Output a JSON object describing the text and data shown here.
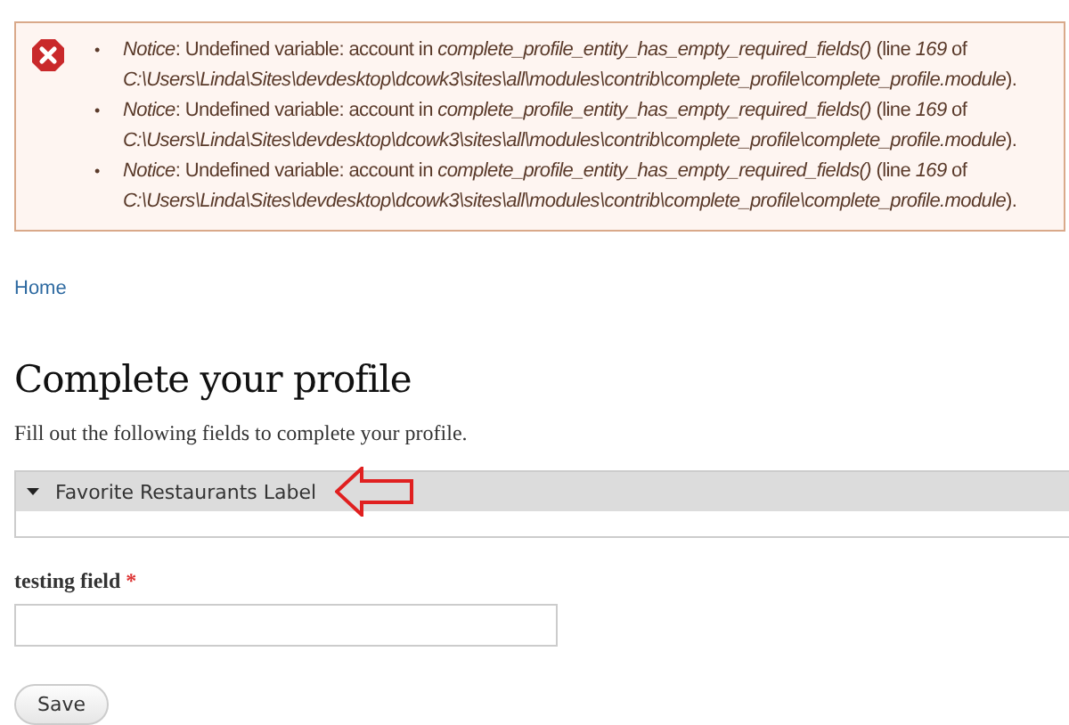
{
  "bullet": "•",
  "messages": [
    {
      "text": "*Notice*: Undefined variable: account in *complete_profile_entity_has_empty_required_fields()* (line *169* of *C:\\Users\\Linda\\Sites\\devdesktop\\dcowk3\\sites\\all\\modules\\contrib\\complete_profile\\complete_profile.module*)."
    },
    {
      "text": "*Notice*: Undefined variable: account in *complete_profile_entity_has_empty_required_fields()* (line *169* of *C:\\Users\\Linda\\Sites\\devdesktop\\dcowk3\\sites\\all\\modules\\contrib\\complete_profile\\complete_profile.module*)."
    },
    {
      "text": "*Notice*: Undefined variable: account in *complete_profile_entity_has_empty_required_fields()* (line *169* of *C:\\Users\\Linda\\Sites\\devdesktop\\dcowk3\\sites\\all\\modules\\contrib\\complete_profile\\complete_profile.module*)."
    }
  ],
  "breadcrumb": [
    "Home"
  ],
  "title": "Complete your profile",
  "description": "Fill out the following fields to complete your profile.",
  "fieldset": {
    "legend": "Favorite Restaurants Label",
    "expanded": true
  },
  "field": {
    "label": "testing field",
    "required_mark": "*"
  },
  "buttons": [
    "Save"
  ]
}
